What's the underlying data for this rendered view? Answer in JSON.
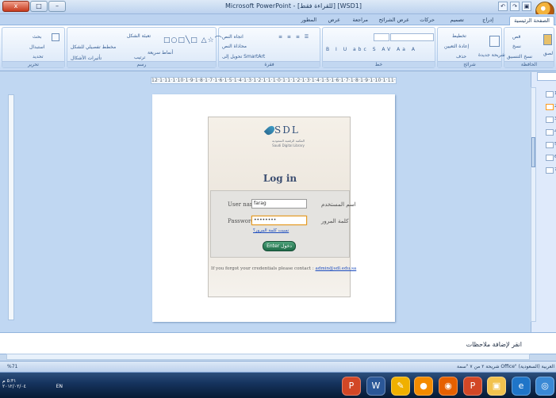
{
  "window": {
    "title": "Microsoft PowerPoint - [للقراءة فقط] [WSD1]",
    "min_label": "–",
    "max_label": "□",
    "close_label": "x"
  },
  "ribbon_tabs": [
    {
      "label": "الصفحة الرئيسية",
      "active": true
    },
    {
      "label": "إدراج"
    },
    {
      "label": "تصميم"
    },
    {
      "label": "حركات"
    },
    {
      "label": "عرض الشرائح"
    },
    {
      "label": "مراجعة"
    },
    {
      "label": "عرض"
    },
    {
      "label": "المطور"
    }
  ],
  "ribbon": {
    "groups": [
      {
        "label": "الحافظة"
      },
      {
        "label": "شرائح"
      },
      {
        "label": "خط"
      },
      {
        "label": "فقرة"
      },
      {
        "label": "رسم"
      },
      {
        "label": "تحرير"
      }
    ],
    "texts": {
      "paste": "لصق",
      "cut": "قص",
      "copy": "نسخ",
      "format_painter": "نسخ التنسيق",
      "new_slide": "شريحة جديدة",
      "layout": "تخطيط",
      "reset": "إعادة التعيين",
      "delete": "حذف",
      "text_direction": "اتجاه النص",
      "align_text": "محاذاة النص",
      "convert_smartart": "تحويل إلى SmartArt",
      "arrange": "ترتيب",
      "quick_styles": "أنماط سريعة",
      "shape_fill": "تعبئة الشكل",
      "shape_outline": "مخطط تفصيلي للشكل",
      "shape_effects": "تأثيرات الأشكال",
      "find": "بحث",
      "replace": "استبدال",
      "select": "تحديد"
    }
  },
  "ruler": {
    "top": "12·1·11·1·10·1·9·1·8·1·7·1·6·1·5·1·4·1·3·1·2·1·1·1·0·1·1·1·2·1·3·1·4·1·5·1·6·1·7·1·8·1·9·1·10·1·11·1·12"
  },
  "slide": {
    "logo": {
      "main": "SDL",
      "subtitle_ar": "المكتبة الرقمية السعودية",
      "subtitle_en": "Saudi Digital Library"
    },
    "heading": "Log in",
    "username": {
      "label_en": "User name:",
      "value": "farag",
      "label_ar": "اسم المستخدم"
    },
    "password": {
      "label_en": "Password:",
      "value": "••••••••",
      "label_ar": "كلمة المرور"
    },
    "forgot": "نسيت كلمة المرور؟",
    "enter_button": "Enter دخول",
    "contact_prefix": "If you forgot your credentials please contact :",
    "contact_email": "admin@sdl.edu.sa"
  },
  "slides_panel": {
    "numbers": [
      "1",
      "2",
      "3",
      "4",
      "5",
      "6",
      "7"
    ],
    "active": 2
  },
  "notes": {
    "placeholder": "انقر لإضافة ملاحظات"
  },
  "status": {
    "zoom": "%71",
    "right": "شريحة ٢ من ٧   \"سمة Office\"   العربية (السعودية)"
  },
  "taskbar": {
    "time": "٥:٣١ م",
    "date": "٢٠١٢/٠٢/٠٤",
    "lang": "EN",
    "icons": [
      {
        "name": "powerpoint-taskbar-icon",
        "glyph": "P",
        "color": "#d24726"
      },
      {
        "name": "word-taskbar-icon",
        "glyph": "W",
        "color": "#2b5797"
      },
      {
        "name": "paint-taskbar-icon",
        "glyph": "✎",
        "color": "#f0b000"
      },
      {
        "name": "media-taskbar-icon",
        "glyph": "●",
        "color": "#f48b00"
      },
      {
        "name": "firefox-taskbar-icon",
        "glyph": "◉",
        "color": "#e66000"
      },
      {
        "name": "powerpoint2-taskbar-icon",
        "glyph": "P",
        "color": "#d24726"
      },
      {
        "name": "folder-taskbar-icon",
        "glyph": "▣",
        "color": "#f2c24e"
      },
      {
        "name": "ie-taskbar-icon",
        "glyph": "e",
        "color": "#1f75c8"
      },
      {
        "name": "start-taskbar-icon",
        "glyph": "◎",
        "color": "#3a89d5"
      }
    ]
  }
}
